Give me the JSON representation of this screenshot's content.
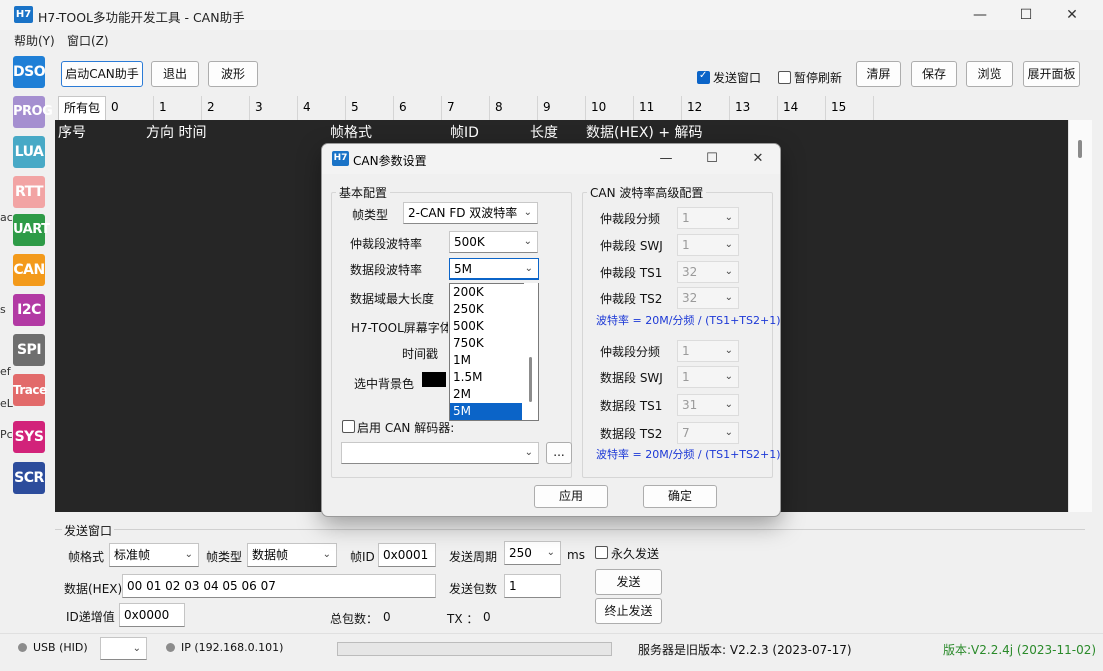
{
  "window": {
    "logo": "H7",
    "title": "H7-TOOL多功能开发工具 - CAN助手",
    "controls": [
      "—",
      "☐",
      "✕"
    ]
  },
  "menu": [
    "帮助(Y)",
    "窗口(Z)"
  ],
  "sidebar": {
    "buttons": [
      {
        "label": "DSO",
        "color": "#1f7fd6"
      },
      {
        "label": "PROG",
        "color": "#a58fd0"
      },
      {
        "label": "LUA",
        "color": "#48a9c6"
      },
      {
        "label": "RTT",
        "color": "#f2a4a4"
      },
      {
        "label": "UART",
        "color": "#2e9b47"
      },
      {
        "label": "CAN",
        "color": "#f39a1b"
      },
      {
        "label": "I2C",
        "color": "#b23aa4"
      },
      {
        "label": "SPI",
        "color": "#6e6e6e"
      },
      {
        "label": "Trace",
        "color": "#e26a6a"
      },
      {
        "label": "SYS",
        "color": "#d2237a"
      },
      {
        "label": "SCR",
        "color": "#2c4c9c"
      }
    ],
    "cut_text": [
      "ac",
      "s",
      "ef",
      "eL",
      "Pc"
    ]
  },
  "toolbar": {
    "start": "启动CAN助手",
    "exit": "退出",
    "wave": "波形",
    "send_window": "发送窗口",
    "pause_refresh": "暂停刷新",
    "clear": "清屏",
    "save": "保存",
    "browse": "浏览",
    "expand": "展开面板"
  },
  "tabs": [
    "所有包",
    "0",
    "1",
    "2",
    "3",
    "4",
    "5",
    "6",
    "7",
    "8",
    "9",
    "10",
    "11",
    "12",
    "13",
    "14",
    "15"
  ],
  "log": {
    "columns": [
      "序号",
      "方向 时间",
      "帧格式",
      "帧ID",
      "长度",
      "数据(HEX) + 解码"
    ]
  },
  "send": {
    "group_title": "发送窗口",
    "frame_format_label": "帧格式",
    "frame_format_value": "标准帧",
    "frame_type_label": "帧类型",
    "frame_type_value": "数据帧",
    "frame_id_label": "帧ID",
    "frame_id_value": "0x0001",
    "period_label": "发送周期",
    "period_value": "250",
    "period_unit": "ms",
    "forever": "永久发送",
    "data_label": "数据(HEX)",
    "data_value": "00 01 02 03 04 05 06 07",
    "count_label": "发送包数",
    "count_value": "1",
    "send_btn": "发送",
    "id_inc_label": "ID递增值",
    "id_inc_value": "0x0000",
    "total_label": "总包数：",
    "total_value": "0",
    "tx_label": "TX ：",
    "tx_value": "0",
    "stop_btn": "终止发送"
  },
  "status": {
    "usb": "USB (HID)",
    "ip": "IP (192.168.0.101)",
    "server": "服务器是旧版本: V2.2.3 (2023-07-17)",
    "version": "版本:V2.2.4j (2023-11-02)",
    "version_color": "#2a8a2a"
  },
  "dialog": {
    "logo": "H7",
    "title": "CAN参数设置",
    "basic": {
      "title": "基本配置",
      "frame_type_label": "帧类型",
      "frame_type_value": "2-CAN FD 双波特率",
      "arb_baud_label": "仲裁段波特率",
      "arb_baud_value": "500K",
      "data_baud_label": "数据段波特率",
      "data_baud_value": "5M",
      "max_len_label": "数据域最大长度",
      "font_label": "H7-TOOL屏幕字体",
      "timestamp_label": "时间戳",
      "sel_bg_label": "选中背景色",
      "decoder_label": "启用 CAN 解码器:",
      "browse_btn": "..."
    },
    "dropdown": {
      "options": [
        "200K",
        "250K",
        "500K",
        "750K",
        "1M",
        "1.5M",
        "2M",
        "5M"
      ],
      "selected": "5M"
    },
    "advanced": {
      "title": "CAN 波特率高级配置",
      "rows": [
        {
          "label": "仲裁段分频",
          "value": "1"
        },
        {
          "label": "仲裁段 SWJ",
          "value": "1"
        },
        {
          "label": "仲裁段 TS1",
          "value": "32"
        },
        {
          "label": "仲裁段 TS2",
          "value": "32"
        },
        {
          "label": "仲裁段分频",
          "value": "1"
        },
        {
          "label": "数据段 SWJ",
          "value": "1"
        },
        {
          "label": "数据段 TS1",
          "value": "31"
        },
        {
          "label": "数据段 TS2",
          "value": "7"
        }
      ],
      "note": "波特率 = 20M/分频 / (TS1+TS2+1)"
    },
    "apply_btn": "应用",
    "ok_btn": "确定"
  }
}
